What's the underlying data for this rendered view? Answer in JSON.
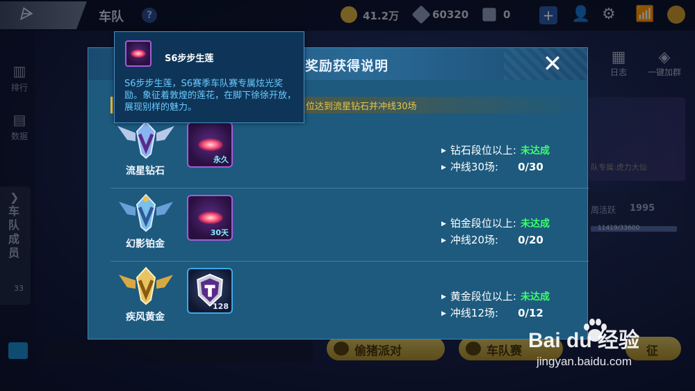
{
  "header": {
    "page_title": "车队",
    "help": "?",
    "coins": "41.2万",
    "diamonds": "60320",
    "gems": "0",
    "add": "+"
  },
  "sidebar_left": {
    "items": [
      {
        "label": "排行",
        "icon": "ranking-icon"
      },
      {
        "label": "数据",
        "icon": "data-icon"
      }
    ],
    "members_label": "车队成员",
    "members_count": "33"
  },
  "sidebar_right": {
    "log_label": "日志",
    "join_label": "一键加群",
    "banner_text": "队专属:虎力大仙",
    "activity_label": "周活跃",
    "activity_value": "1995",
    "activity_progress": "11419/33600"
  },
  "bottom": {
    "pill1": "偷猪派对",
    "pill2": "车队赛",
    "pill3": "征"
  },
  "modal": {
    "title": "车队奖励获得说明",
    "close": "✕",
    "notice": "位达到流星钻石并冲线30场",
    "rows": [
      {
        "rank": "流星钻石",
        "reward_tag": "永久",
        "cond1_label": "钻石段位以上:",
        "cond1_status": "未达成",
        "cond2_label": "冲线30场:",
        "cond2_progress": "0/30"
      },
      {
        "rank": "幻影铂金",
        "reward_tag": "30天",
        "cond1_label": "铂金段位以上:",
        "cond1_status": "未达成",
        "cond2_label": "冲线20场:",
        "cond2_progress": "0/20"
      },
      {
        "rank": "疾风黄金",
        "reward_tag": "128",
        "cond1_label": "黄金段位以上:",
        "cond1_status": "未达成",
        "cond2_label": "冲线12场:",
        "cond2_progress": "0/12"
      }
    ]
  },
  "tooltip": {
    "title": "S6步步生莲",
    "description": "S6步步生莲，S6赛季车队赛专属炫光奖励。象征着敦煌的莲花，在脚下徐徐开放，展现别样的魅力。"
  },
  "watermark": {
    "logo": "Bai du 经验",
    "url": "jingyan.baidu.com"
  },
  "colors": {
    "modal_bg": "#1d5a7e",
    "status_green": "#3aff6a",
    "notice_gold": "#e8c44a",
    "tooltip_text": "#6acbff"
  }
}
